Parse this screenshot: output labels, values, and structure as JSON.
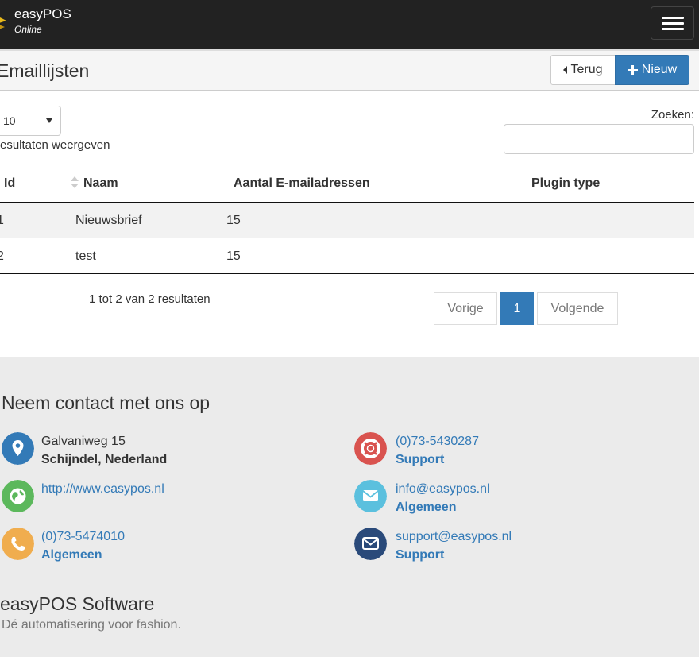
{
  "app": {
    "brand_name": "easyPOS",
    "brand_sub": "Online"
  },
  "colors": {
    "primary": "#337ab7",
    "navbar_bg": "#222222",
    "footer_bg": "#ebebeb",
    "icon_address": "#337ab7",
    "icon_web": "#5cb85c",
    "icon_phone": "#f0ad4e",
    "icon_support_phone": "#d9534f",
    "icon_mail": "#5bc0de",
    "icon_support_mail": "#2a4a7a"
  },
  "header": {
    "title": "Emaillijsten",
    "back_label": "Terug",
    "new_label": "Nieuw"
  },
  "table_controls": {
    "length_value": "10",
    "length_label": "resultaten weergeven",
    "search_label": "Zoeken:",
    "search_value": ""
  },
  "table": {
    "columns": [
      "Id",
      "Naam",
      "Aantal E-mailadressen",
      "Plugin type"
    ],
    "rows": [
      {
        "id": "1",
        "naam": "Nieuwsbrief",
        "aantal": "15",
        "plugin": ""
      },
      {
        "id": "2",
        "naam": "test",
        "aantal": "15",
        "plugin": ""
      }
    ],
    "info": "1 tot 2 van 2 resultaten",
    "pagination": {
      "prev": "Vorige",
      "current": "1",
      "next": "Volgende"
    }
  },
  "footer": {
    "title": "Neem contact met ons op",
    "contacts": [
      {
        "icon": "map-marker-icon",
        "line1": "Galvaniweg 15",
        "line2": "Schijndel, Nederland"
      },
      {
        "icon": "globe-icon",
        "line1": "http://www.easypos.nl",
        "line2": ""
      },
      {
        "icon": "phone-icon",
        "line1": "(0)73-5474010",
        "line2": "Algemeen"
      },
      {
        "icon": "life-ring-icon",
        "line1": "(0)73-5430287",
        "line2": "Support"
      },
      {
        "icon": "envelope-icon",
        "line1": "info@easypos.nl",
        "line2": "Algemeen"
      },
      {
        "icon": "envelope-icon",
        "line1": "support@easypos.nl",
        "line2": "Support"
      }
    ],
    "company": "easyPOS Software",
    "slogan": "Dé automatisering voor fashion."
  }
}
